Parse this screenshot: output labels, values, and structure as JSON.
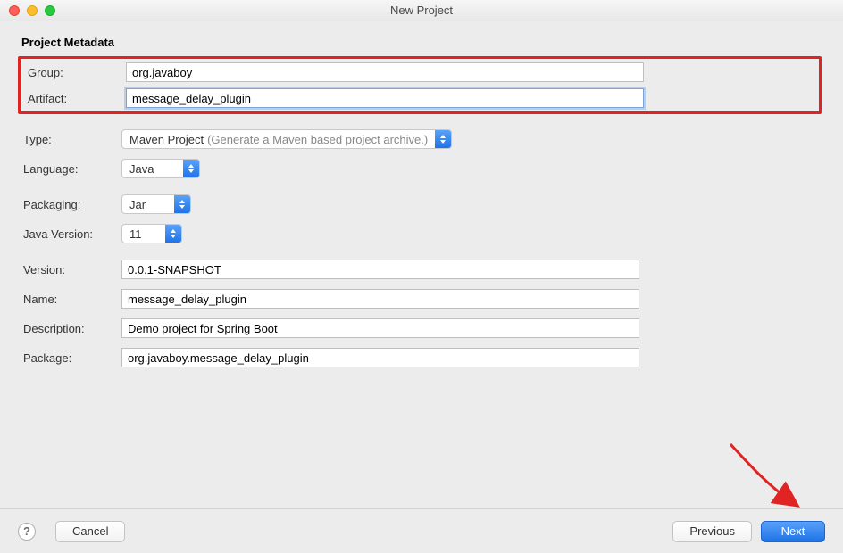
{
  "window": {
    "title": "New Project"
  },
  "section": {
    "title": "Project Metadata"
  },
  "labels": {
    "group": "Group:",
    "artifact": "Artifact:",
    "type": "Type:",
    "language": "Language:",
    "packaging": "Packaging:",
    "java_version": "Java Version:",
    "version": "Version:",
    "name": "Name:",
    "description": "Description:",
    "package": "Package:"
  },
  "fields": {
    "group": "org.javaboy",
    "artifact": "message_delay_plugin",
    "type": {
      "value": "Maven Project",
      "hint": "(Generate a Maven based project archive.)"
    },
    "language": "Java",
    "packaging": "Jar",
    "java_version": "11",
    "version": "0.0.1-SNAPSHOT",
    "name": "message_delay_plugin",
    "description": "Demo project for Spring Boot",
    "package": "org.javaboy.message_delay_plugin"
  },
  "buttons": {
    "help": "?",
    "cancel": "Cancel",
    "previous": "Previous",
    "next": "Next"
  }
}
